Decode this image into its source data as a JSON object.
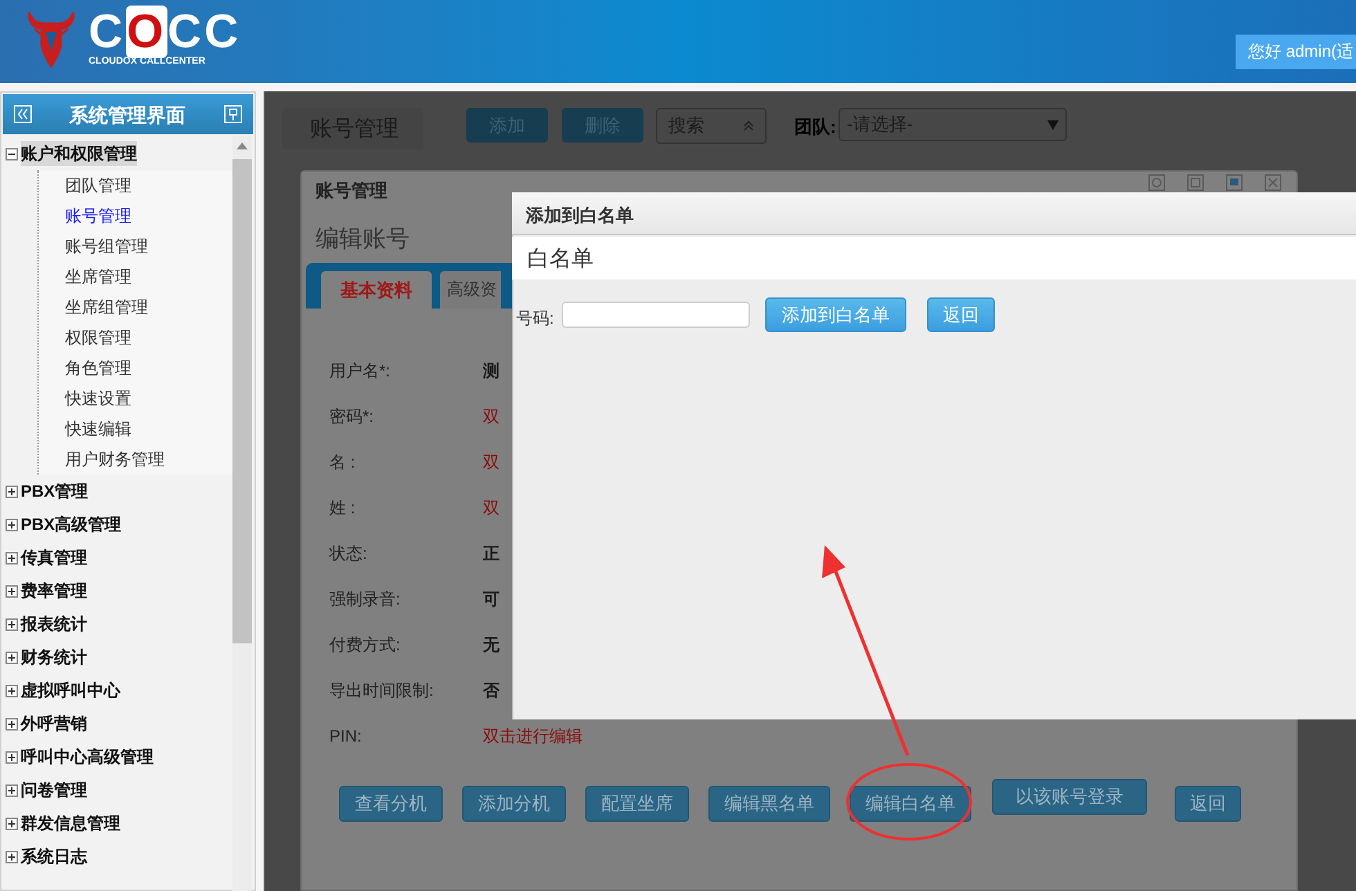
{
  "header": {
    "logo_parts": [
      {
        "text": "C",
        "accent": false
      },
      {
        "text": "O",
        "accent": true
      },
      {
        "text": "CC",
        "accent": false
      }
    ],
    "logo_subtitle": "CLOUDOX CALLCENTER",
    "greeting": "您好 admin(适"
  },
  "sidebar": {
    "title": "系统管理界面",
    "tree": [
      {
        "label": "账户和权限管理",
        "expanded": true,
        "children": [
          {
            "label": "团队管理",
            "selected": false
          },
          {
            "label": "账号管理",
            "selected": true
          },
          {
            "label": "账号组管理",
            "selected": false
          },
          {
            "label": "坐席管理",
            "selected": false
          },
          {
            "label": "坐席组管理",
            "selected": false
          },
          {
            "label": "权限管理",
            "selected": false
          },
          {
            "label": "角色管理",
            "selected": false
          },
          {
            "label": "快速设置",
            "selected": false
          },
          {
            "label": "快速编辑",
            "selected": false
          },
          {
            "label": "用户财务管理",
            "selected": false
          }
        ]
      },
      {
        "label": "PBX管理",
        "expanded": false
      },
      {
        "label": "PBX高级管理",
        "expanded": false
      },
      {
        "label": "传真管理",
        "expanded": false
      },
      {
        "label": "费率管理",
        "expanded": false
      },
      {
        "label": "报表统计",
        "expanded": false
      },
      {
        "label": "财务统计",
        "expanded": false
      },
      {
        "label": "虚拟呼叫中心",
        "expanded": false
      },
      {
        "label": "外呼营销",
        "expanded": false
      },
      {
        "label": "呼叫中心高级管理",
        "expanded": false
      },
      {
        "label": "问卷管理",
        "expanded": false
      },
      {
        "label": "群发信息管理",
        "expanded": false
      },
      {
        "label": "系统日志",
        "expanded": false
      }
    ]
  },
  "toolbar": {
    "tab": "账号管理",
    "buttons": [
      "添加",
      "删除"
    ],
    "search_select": "搜索",
    "team_label": "团队:",
    "team_select": "-请选择-"
  },
  "account_dialog": {
    "title": "账号管理",
    "subtitle": "编辑账号",
    "tabs": [
      {
        "label": "基本资料",
        "selected": true
      },
      {
        "label": "高级资",
        "selected": false
      }
    ],
    "fields": [
      {
        "label": "用户名*:",
        "value": "测",
        "kind": "plain"
      },
      {
        "label": "密码*:",
        "value": "双",
        "kind": "link"
      },
      {
        "label": "名 :",
        "value": "双",
        "kind": "link"
      },
      {
        "label": "姓 :",
        "value": "双",
        "kind": "link"
      },
      {
        "label": "状态:",
        "value": "正",
        "kind": "plain"
      },
      {
        "label": "强制录音:",
        "value": "可",
        "kind": "plain"
      },
      {
        "label": "付费方式:",
        "value": "无",
        "kind": "plain"
      },
      {
        "label": "导出时间限制:",
        "value": "否",
        "kind": "plain"
      },
      {
        "label": "PIN:",
        "value": "双击进行编辑",
        "kind": "link"
      }
    ],
    "buttons": [
      "查看分机",
      "添加分机",
      "配置坐席",
      "编辑黑名单",
      "编辑白名单",
      "以该账号登录",
      "返回"
    ]
  },
  "whitelist_dialog": {
    "title": "添加到白名单",
    "heading": "白名单",
    "number_label": "号码:",
    "buttons": [
      "添加到白名单",
      "返回"
    ]
  }
}
